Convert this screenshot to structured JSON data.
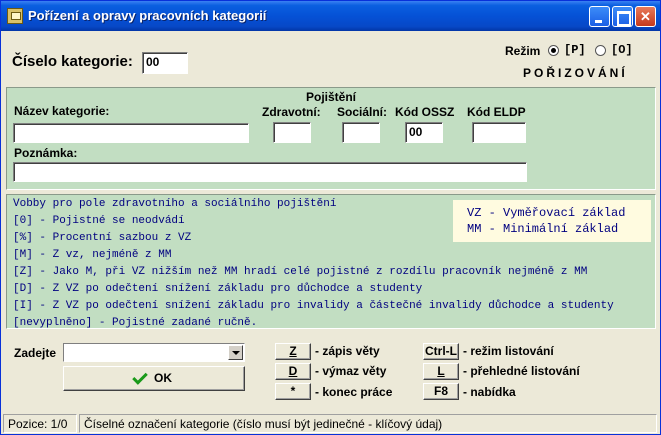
{
  "window": {
    "title": "Pořízení a opravy pracovních kategorií"
  },
  "header": {
    "category_number_label": "Číselo kategorie:",
    "category_number_value": "00",
    "mode_label": "Režim",
    "mode_p": "[P]",
    "mode_o": "[O]",
    "mode_selected": "P",
    "mode_status": "POŘIZOVÁNÍ"
  },
  "form": {
    "group_label": "Pojištění",
    "name_label": "Název kategorie:",
    "name_value": "",
    "health_label": "Zdravotní:",
    "health_value": "",
    "social_label": "Sociální:",
    "social_value": "",
    "ossz_label": "Kód OSSZ",
    "ossz_value": "00",
    "eldp_label": "Kód ELDP",
    "eldp_value": "",
    "note_label": "Poznámka:",
    "note_value": ""
  },
  "info": {
    "lines": [
      "Vobby pro pole zdravotního a sociálního pojištění",
      "[0] - Pojistné se neodvádí",
      "[%] - Procentní sazbou z VZ",
      "[M] - Z vz, nejméně z MM",
      "[Z] - Jako M, při VZ nižším než MM hradí celé pojistné z rozdílu pracovník nejméně z MM",
      "[D] - Z VZ po odečtení snížení základu pro důchodce a studenty",
      "[I] - Z VZ po odečtení snížení základu pro invalidy a částečné invalidy důchodce a studenty",
      "[nevyplněno] - Pojistné zadané ručně."
    ],
    "legend": [
      "VZ - Vyměřovací základ",
      "MM - Minimální základ"
    ]
  },
  "bottom": {
    "enter_label": "Zadejte",
    "combo_value": "",
    "ok_label": "OK",
    "keys": [
      {
        "key": "Z",
        "desc": "- zápis věty"
      },
      {
        "key": "D",
        "desc": "- výmaz věty"
      },
      {
        "key": "*",
        "desc": "- konec práce"
      },
      {
        "key": "Ctrl-L",
        "desc": "- režim listování"
      },
      {
        "key": "L",
        "desc": "- přehledné listování"
      },
      {
        "key": "F8",
        "desc": "- nabídka"
      }
    ]
  },
  "status": {
    "position": "Pozice: 1/0",
    "message": "Číselné označení kategorie (číslo musí být jedinečné - klíčový údaj)"
  },
  "colors": {
    "titlebar": "#0551d6",
    "panel": "#c2dec2",
    "info_text": "#000080",
    "legend_bg": "#fffbe0"
  }
}
